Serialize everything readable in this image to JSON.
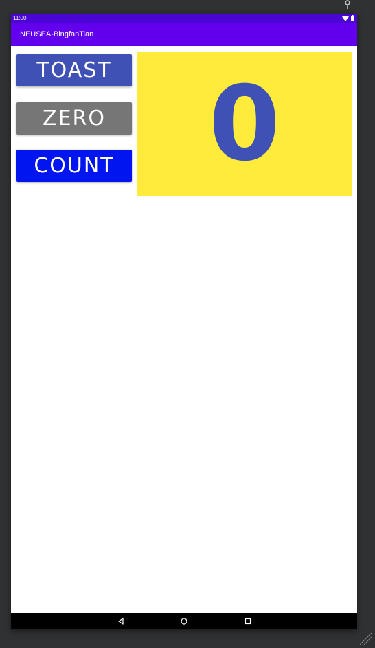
{
  "status_bar": {
    "time": "11:00",
    "icons": [
      "wifi-icon",
      "battery-icon"
    ]
  },
  "app_bar": {
    "title": "NEUSEA-BingfanTian"
  },
  "buttons": {
    "toast": "TOAST",
    "zero": "ZERO",
    "count": "COUNT"
  },
  "counter": {
    "value": "0"
  },
  "nav_bar": {
    "icons": [
      "back-icon",
      "home-icon",
      "recents-icon"
    ]
  },
  "colors": {
    "status_bar": "#4a05d4",
    "app_bar": "#6200ee",
    "toast_button": "#3f51b5",
    "zero_button": "#767676",
    "count_button": "#0015f0",
    "count_panel": "#ffeb3b",
    "count_text": "#3f51b5"
  }
}
